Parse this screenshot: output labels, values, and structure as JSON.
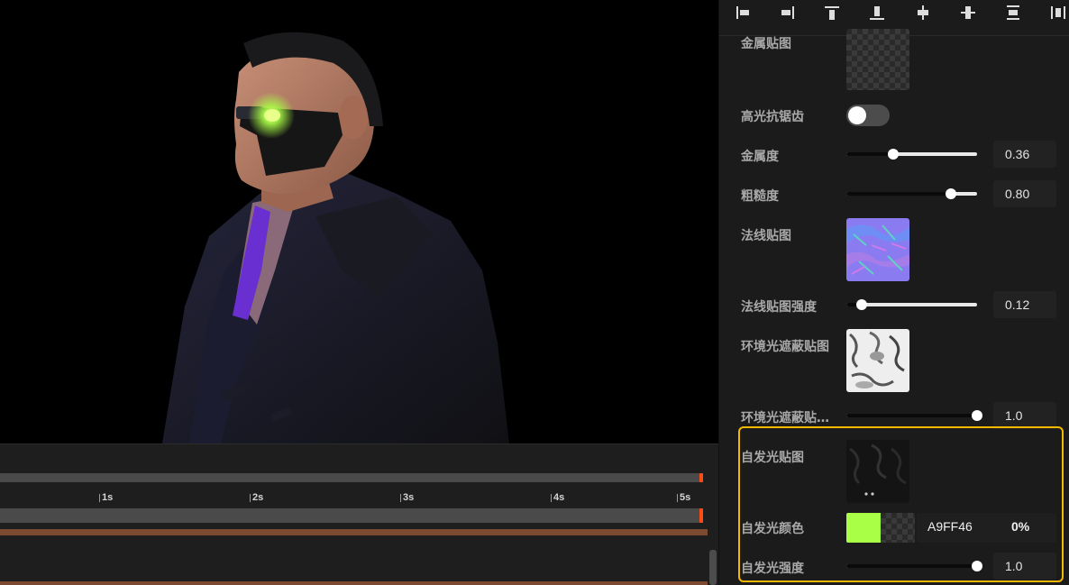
{
  "timeline": {
    "ticks": [
      "1s",
      "2s",
      "3s",
      "4s",
      "5s"
    ]
  },
  "toolbar": {
    "align_icons": [
      "align-left-icon",
      "align-right-icon",
      "align-top-icon",
      "align-bottom-icon",
      "align-horizontal-center-icon",
      "align-vertical-center-icon",
      "distribute-vertical-icon",
      "distribute-horizontal-icon"
    ]
  },
  "properties": {
    "metal_map": {
      "label": "金属贴图"
    },
    "specular_aa": {
      "label": "高光抗锯齿",
      "enabled": false
    },
    "metalness": {
      "label": "金属度",
      "value": "0.36",
      "level": 0.36
    },
    "roughness": {
      "label": "粗糙度",
      "value": "0.80",
      "level": 0.8
    },
    "normal_map": {
      "label": "法线贴图"
    },
    "normal_strength": {
      "label": "法线贴图强度",
      "value": "0.12",
      "level": 0.12
    },
    "ao_map": {
      "label": "环境光遮蔽贴图"
    },
    "ao_strength": {
      "label": "环境光遮蔽贴…",
      "value": "1.0",
      "level": 1.0
    },
    "emissive_map": {
      "label": "自发光贴图"
    },
    "emissive_color": {
      "label": "自发光颜色",
      "hex": "A9FF46",
      "swatch": "#a9ff46",
      "opacity": "0%"
    },
    "emissive_strength": {
      "label": "自发光强度",
      "value": "1.0",
      "level": 1.0
    }
  },
  "colors": {
    "highlight": "#f5b800",
    "timeline_marker": "#ff4b14"
  }
}
